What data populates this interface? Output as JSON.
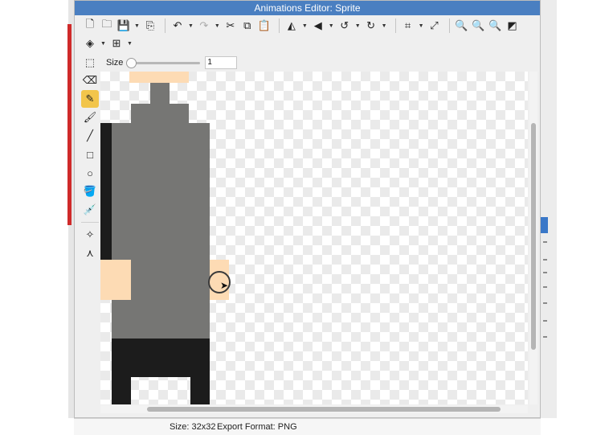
{
  "window": {
    "title": "Animations Editor: Sprite"
  },
  "toolbar": {
    "row1": [
      {
        "name": "new-file-button",
        "icon": "new-file-icon",
        "glyph": "🗋"
      },
      {
        "name": "open-button",
        "icon": "folder-icon",
        "glyph": "🗀"
      },
      {
        "name": "save-button",
        "icon": "save-icon",
        "glyph": "💾",
        "arrow": true
      },
      {
        "name": "export-button",
        "icon": "export-icon",
        "glyph": "⎘"
      },
      {
        "sep": true
      },
      {
        "name": "undo-button",
        "icon": "undo-icon",
        "glyph": "↶",
        "arrow": true
      },
      {
        "name": "redo-button",
        "icon": "redo-icon",
        "glyph": "↷",
        "arrow": true,
        "disabled": true
      },
      {
        "name": "cut-button",
        "icon": "scissors-icon",
        "glyph": "✂"
      },
      {
        "name": "copy-button",
        "icon": "copy-icon",
        "glyph": "⧉"
      },
      {
        "name": "paste-button",
        "icon": "clipboard-icon",
        "glyph": "📋"
      },
      {
        "sep": true
      },
      {
        "name": "flip-horizontal-button",
        "icon": "flip-horizontal-icon",
        "glyph": "◭",
        "arrow": true
      },
      {
        "name": "flip-vertical-button",
        "icon": "flip-vertical-icon",
        "glyph": "◀",
        "arrow": true
      },
      {
        "name": "rotate-left-button",
        "icon": "rotate-left-icon",
        "glyph": "↺",
        "arrow": true
      },
      {
        "name": "rotate-right-button",
        "icon": "rotate-right-icon",
        "glyph": "↻",
        "arrow": true
      },
      {
        "sep": true
      },
      {
        "name": "crop-button",
        "icon": "crop-icon",
        "glyph": "⌗",
        "arrow": true
      },
      {
        "name": "resize-button",
        "icon": "expand-icon",
        "glyph": "⤢"
      },
      {
        "sep": true
      },
      {
        "name": "zoom-in-button",
        "icon": "zoom-in-icon",
        "glyph": "🔍"
      },
      {
        "name": "zoom-out-button",
        "icon": "zoom-out-icon",
        "glyph": "🔍"
      },
      {
        "name": "zoom-fit-button",
        "icon": "zoom-fit-icon",
        "glyph": "🔍"
      },
      {
        "name": "fullscreen-button",
        "icon": "fullscreen-icon",
        "glyph": "◩"
      }
    ],
    "row2": [
      {
        "name": "layers-button",
        "icon": "layers-icon",
        "glyph": "◈",
        "arrow": true
      },
      {
        "name": "grid-button",
        "icon": "grid-icon",
        "glyph": "⊞",
        "arrow": true
      }
    ]
  },
  "options": {
    "select_icon": "selection-rect-icon",
    "size_label": "Size",
    "size_value": "1",
    "size_fraction": 0.0
  },
  "tools": [
    {
      "name": "tool-eraser",
      "icon": "eraser-icon",
      "glyph": "⌫"
    },
    {
      "name": "tool-pencil",
      "icon": "pencil-icon",
      "glyph": "✎",
      "active": true
    },
    {
      "name": "tool-brush",
      "icon": "brush-icon",
      "glyph": "🖌"
    },
    {
      "name": "tool-line",
      "icon": "line-icon",
      "glyph": "╱"
    },
    {
      "name": "tool-rectangle",
      "icon": "rectangle-icon",
      "glyph": "□"
    },
    {
      "name": "tool-ellipse",
      "icon": "ellipse-icon",
      "glyph": "○"
    },
    {
      "name": "tool-fill",
      "icon": "paint-bucket-icon",
      "glyph": "🪣"
    },
    {
      "name": "tool-eyedropper",
      "icon": "eyedropper-icon",
      "glyph": "💉"
    },
    {
      "sep": true
    },
    {
      "name": "tool-magic-wand",
      "icon": "magic-wand-icon",
      "glyph": "✧"
    },
    {
      "name": "tool-transform",
      "icon": "transform-icon",
      "glyph": "⋏"
    }
  ],
  "colors": {
    "skin": "#fddbb4",
    "gray": "#767674",
    "black": "#1c1c1c",
    "active_tool": "#f2c54b",
    "titlebar": "#4a7fc1"
  },
  "status": {
    "size": "Size: 32x32",
    "format": "Export Format: PNG"
  }
}
